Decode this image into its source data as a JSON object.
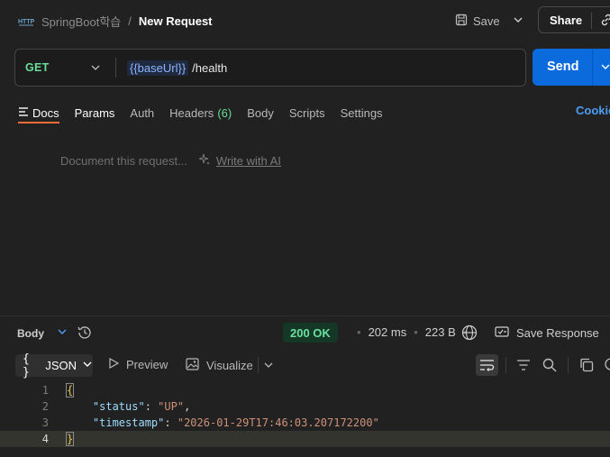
{
  "header": {
    "badge": "HTTP",
    "collection": "SpringBoot학습",
    "separator": "/",
    "request_name": "New Request",
    "save_label": "Save",
    "share_label": "Share"
  },
  "request": {
    "method": "GET",
    "url_variable": "{{baseUrl}}",
    "url_path": "/health",
    "send_label": "Send"
  },
  "tabs": {
    "docs": "Docs",
    "params": "Params",
    "auth": "Auth",
    "headers": "Headers",
    "headers_count": "(6)",
    "body": "Body",
    "scripts": "Scripts",
    "settings": "Settings",
    "cookies": "Cookie"
  },
  "docs": {
    "placeholder": "Document this request...",
    "write_ai": "Write with AI"
  },
  "response": {
    "body_label": "Body",
    "status": "200 OK",
    "time": "202 ms",
    "size": "223 B",
    "save_response": "Save Response",
    "format": "JSON",
    "preview": "Preview",
    "visualize": "Visualize",
    "lines": [
      {
        "num": "1"
      },
      {
        "num": "2",
        "key": "\"status\"",
        "value": "\"UP\""
      },
      {
        "num": "3",
        "key": "\"timestamp\"",
        "value": "\"2026-01-29T17:46:03.207172200\""
      },
      {
        "num": "4"
      }
    ],
    "open_brace": "{",
    "close_brace": "}"
  },
  "colors": {
    "accent_orange": "#ff6c37",
    "send_blue": "#0b6bdd",
    "method_green": "#6bdd9a",
    "status_green": "#69e0a0"
  }
}
